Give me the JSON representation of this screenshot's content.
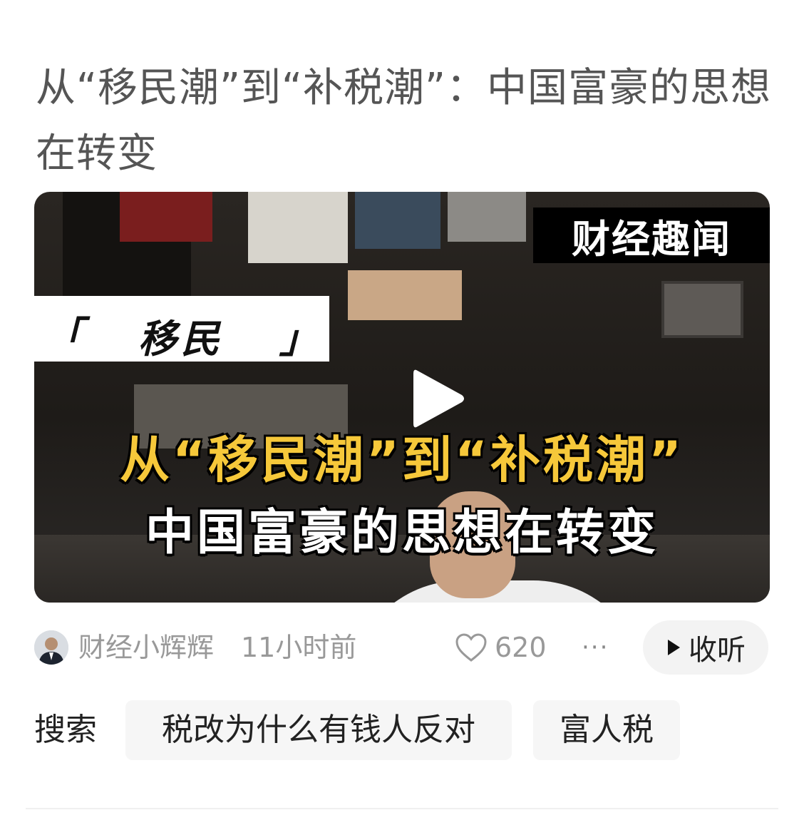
{
  "article": {
    "title": "从“移民潮”到“补税潮”：中国富豪的思想在转变"
  },
  "video": {
    "badge_text": "财经趣闻",
    "tag_bracket_left": "「",
    "tag_word": "移民",
    "tag_bracket_right": "」",
    "caption_line1": "从“移民潮”到“补税潮”",
    "caption_line2": "中国富豪的思想在转变",
    "play_icon": "play-icon"
  },
  "meta": {
    "author": "财经小辉辉",
    "time": "11小时前",
    "like_count": "620",
    "more_label": "···",
    "listen_label": "收听",
    "icons": [
      "heart-icon",
      "play-small-icon",
      "more-icon"
    ]
  },
  "search": {
    "label": "搜索",
    "chips": [
      "税改为什么有钱人反对",
      "富人税"
    ]
  },
  "colors": {
    "caption_yellow": "#f6c83a",
    "muted_text": "#999999",
    "chip_bg": "#f6f6f6"
  }
}
